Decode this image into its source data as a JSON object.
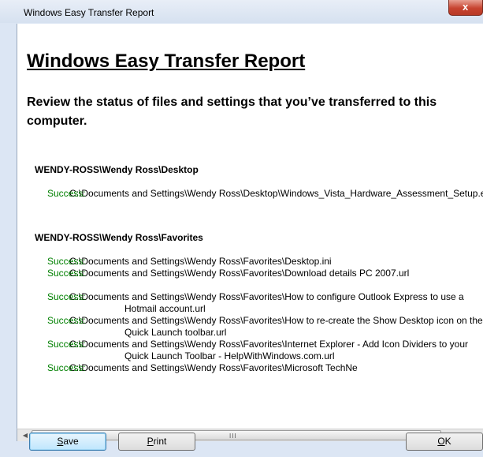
{
  "window": {
    "title": "Windows Easy Transfer Report",
    "close_glyph": "x"
  },
  "report": {
    "title": "Windows Easy Transfer Report",
    "subtitle": "Review the status of files and settings that you’ve transferred to this computer.",
    "sections": [
      {
        "header": "WENDY-ROSS\\Wendy Ross\\Desktop",
        "entries": [
          {
            "status": "Success:",
            "path": "C:\\Documents and Settings\\Wendy Ross\\Desktop\\Windows_Vista_Hardware_Assessment_Setup.exe"
          }
        ]
      },
      {
        "header": "WENDY-ROSS\\Wendy Ross\\Favorites",
        "entries": [
          {
            "status": "Success:",
            "path": "C:\\Documents and Settings\\Wendy Ross\\Favorites\\Desktop.ini"
          },
          {
            "status": "Success:",
            "path": "C:\\Documents and Settings\\Wendy Ross\\Favorites\\Download details PC 2007.url"
          },
          {
            "status": "Success:",
            "path": "C:\\Documents and Settings\\Wendy Ross\\Favorites\\How to configure Outlook Express to use a Hotmail account.url"
          },
          {
            "status": "Success:",
            "path": "C:\\Documents and Settings\\Wendy Ross\\Favorites\\How to re-create the Show Desktop icon on the Quick Launch toolbar.url"
          },
          {
            "status": "Success:",
            "path": "C:\\Documents and Settings\\Wendy Ross\\Favorites\\Internet Explorer - Add Icon Dividers to your Quick Launch Toolbar - HelpWithWindows.com.url"
          },
          {
            "status": "Success:",
            "path": "C:\\Documents and Settings\\Wendy Ross\\Favorites\\Microsoft TechNe"
          }
        ]
      }
    ]
  },
  "scrollbar": {
    "left_icon": "scroll-left-arrow",
    "right_icon": "scroll-right-arrow",
    "grip": "III"
  },
  "buttons": {
    "save": {
      "mnemonic": "S",
      "rest": "ave"
    },
    "print": {
      "mnemonic": "P",
      "rest": "rint"
    },
    "ok": {
      "mnemonic": "O",
      "rest": "K"
    }
  },
  "colors": {
    "success": "#008000",
    "window_frame": "#dce6f4",
    "close_button": "#c7432f"
  }
}
